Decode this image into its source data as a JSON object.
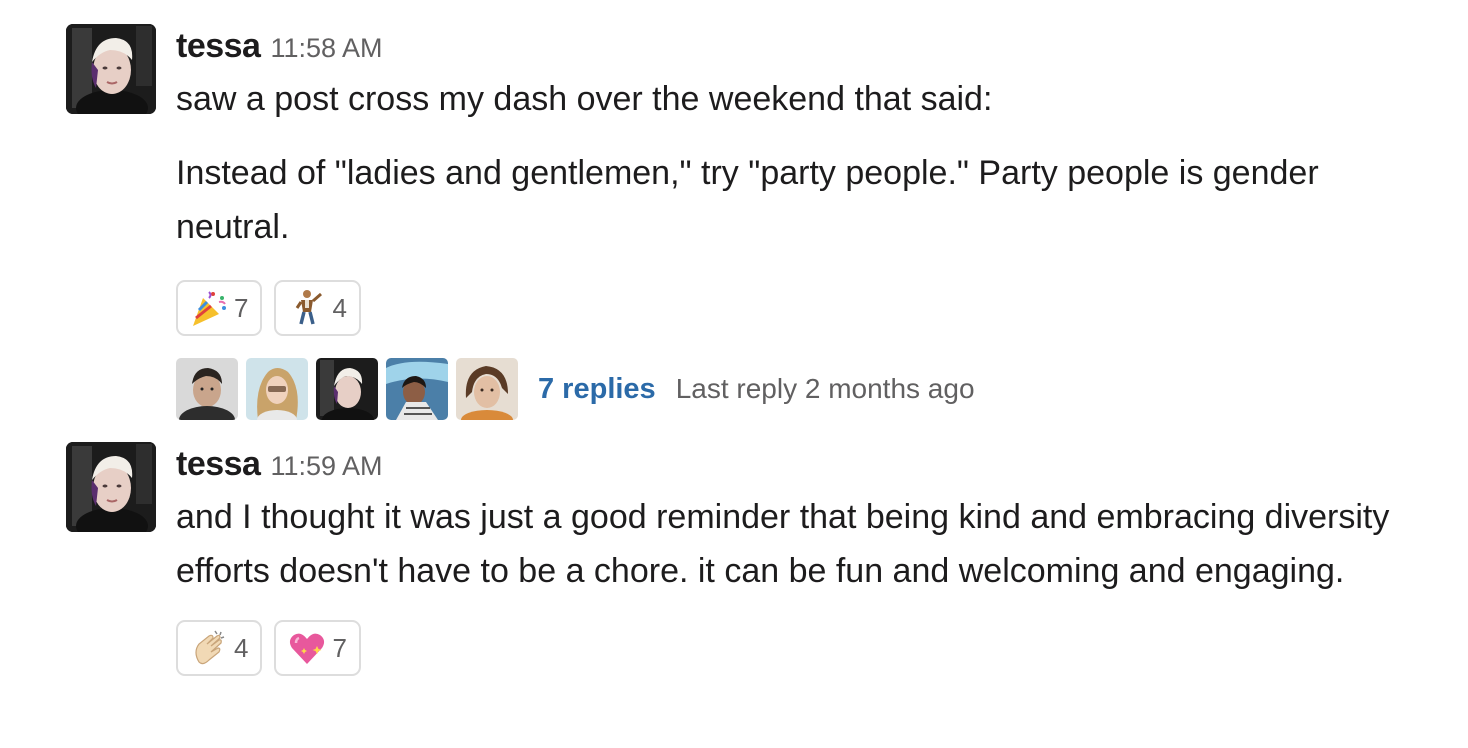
{
  "messages": [
    {
      "username": "tessa",
      "time": "11:58 AM",
      "text_lines": [
        "saw a post cross my dash over the weekend that said:",
        "Instead of \"ladies and gentlemen,\" try \"party people.\" Party people is gender neutral."
      ],
      "reactions": [
        {
          "emoji": "party-popper-icon",
          "count": "7"
        },
        {
          "emoji": "dancing-man-icon",
          "count": "4"
        }
      ],
      "thread": {
        "participants": [
          "avatar-1",
          "avatar-2",
          "avatar-3",
          "avatar-4",
          "avatar-5"
        ],
        "replies_label": "7 replies",
        "last_reply_label": "Last reply 2 months ago"
      }
    },
    {
      "username": "tessa",
      "time": "11:59 AM",
      "text_lines": [
        "and I thought it was just a good reminder that being kind and embracing diversity efforts doesn't have to be a chore. it can be fun and welcoming and engaging."
      ],
      "reactions": [
        {
          "emoji": "clapping-hands-icon",
          "count": "4"
        },
        {
          "emoji": "sparkling-heart-icon",
          "count": "7"
        }
      ]
    }
  ],
  "colors": {
    "link": "#2b6aa8",
    "muted": "#616061",
    "text": "#1d1c1d",
    "reaction_border": "#dddddd"
  }
}
